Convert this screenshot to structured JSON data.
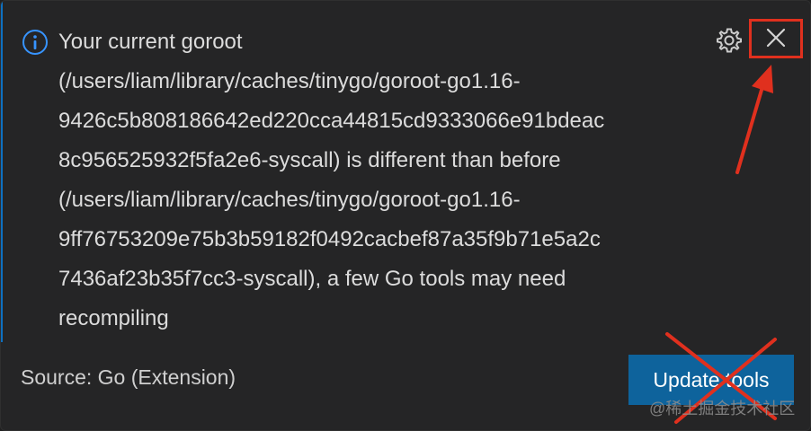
{
  "notification": {
    "message": "Your current goroot\n(/users/liam/library/caches/tinygo/goroot-go1.16-\n9426c5b808186642ed220cca44815cd9333066e91bdeac\n8c956525932f5fa2e6-syscall) is different than before\n(/users/liam/library/caches/tinygo/goroot-go1.16-\n9ff76753209e75b3b59182f0492cacbef87a35f9b71e5a2c\n7436af23b35f7cc3-syscall), a few Go tools may need\nrecompiling",
    "source": "Source: Go (Extension)",
    "action_label": "Update tools",
    "icons": {
      "info": "info-icon",
      "settings": "gear-icon",
      "close": "close-icon"
    }
  },
  "watermark": "@稀土掘金技术社区",
  "colors": {
    "background": "#252526",
    "button": "#0e639c",
    "annotation": "#e0301e",
    "info": "#3794ff"
  }
}
